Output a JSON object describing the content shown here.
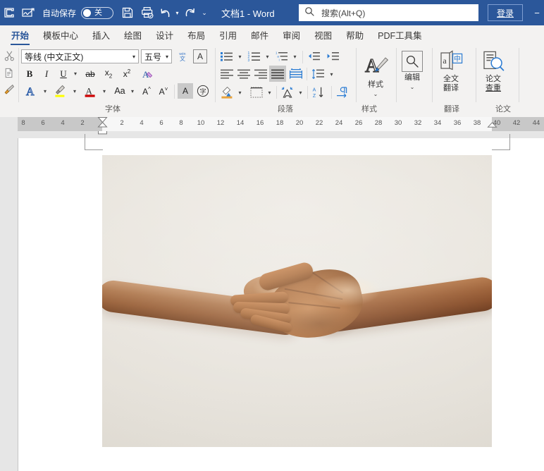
{
  "titlebar": {
    "autosave_label": "自动保存",
    "autosave_state": "关",
    "document_title": "文档1  -  Word",
    "signin_label": "登录",
    "icons": {
      "word_logo": "word-logo-icon",
      "signature": "signature-icon",
      "save": "save-icon",
      "print_preview": "print-preview-icon",
      "undo": "undo-icon",
      "redo": "redo-icon",
      "customize": "customize-qat-icon",
      "minimize": "minimize-icon"
    }
  },
  "search": {
    "placeholder": "搜索(Alt+Q)",
    "icon": "search-icon"
  },
  "tabs": [
    {
      "label": "开始",
      "active": true
    },
    {
      "label": "模板中心",
      "active": false
    },
    {
      "label": "插入",
      "active": false
    },
    {
      "label": "绘图",
      "active": false
    },
    {
      "label": "设计",
      "active": false
    },
    {
      "label": "布局",
      "active": false
    },
    {
      "label": "引用",
      "active": false
    },
    {
      "label": "邮件",
      "active": false
    },
    {
      "label": "审阅",
      "active": false
    },
    {
      "label": "视图",
      "active": false
    },
    {
      "label": "帮助",
      "active": false
    },
    {
      "label": "PDF工具集",
      "active": false
    }
  ],
  "ribbon": {
    "groups": [
      {
        "name": "clipboard",
        "label": ""
      },
      {
        "name": "font",
        "label": "字体"
      },
      {
        "name": "paragraph",
        "label": "段落"
      },
      {
        "name": "styles",
        "label": "样式"
      },
      {
        "name": "translate",
        "label": "翻译"
      },
      {
        "name": "thesis",
        "label": "论文"
      }
    ],
    "clipboard": {
      "cut": "cut-icon",
      "copy": "copy-icon",
      "format_painter": "format-painter-icon"
    },
    "font": {
      "font_name": "等线 (中文正文)",
      "font_size": "五号",
      "bold": "B",
      "italic": "I",
      "underline": "U",
      "strikethrough": "ab",
      "subscript": "x₂",
      "superscript": "x²",
      "phonetic_guide": "拼音指南",
      "character_border": "字符边框",
      "text_effects": "文本效果",
      "highlight": "突出显示",
      "font_color": "字体颜色",
      "change_case": "Aa",
      "grow_font": "增大字号",
      "shrink_font": "减小字号",
      "text_shading": "字符底纹",
      "enclose_character": "带圈字符",
      "clear_formatting": "清除格式"
    },
    "paragraph": {
      "bullets": "bullet-list-icon",
      "numbering": "numbered-list-icon",
      "multilevel": "multilevel-list-icon",
      "decrease_indent": "decrease-indent-icon",
      "increase_indent": "increase-indent-icon",
      "align_left": "align-left-icon",
      "align_center": "align-center-icon",
      "align_right": "align-right-icon",
      "justify": "justify-icon",
      "distribute": "distribute-icon",
      "line_spacing": "line-spacing-icon",
      "shading": "shading-icon",
      "borders": "borders-icon",
      "asian_layout": "asian-layout-icon",
      "sort": "sort-icon",
      "show_marks": "show-paragraph-marks-icon"
    },
    "styles": {
      "label": "样式",
      "icon": "styles-icon"
    },
    "editing": {
      "label": "编辑",
      "icon": "find-icon"
    },
    "translate": {
      "label": "全文\n翻译",
      "line1": "全文",
      "line2": "翻译",
      "icon": "translate-icon"
    },
    "thesis": {
      "line1": "论文",
      "line2": "查重",
      "icon": "plagiarism-check-icon"
    }
  },
  "ruler": {
    "left_numbers": [
      "8",
      "6",
      "4",
      "2"
    ],
    "right_numbers": [
      "2",
      "4",
      "6",
      "8",
      "10",
      "12",
      "14",
      "16",
      "18",
      "20",
      "22",
      "24",
      "26",
      "28",
      "30",
      "32",
      "34",
      "36",
      "38",
      "40",
      "42",
      "44"
    ],
    "left_indent_marker": "left-indent-marker",
    "right_indent_marker": "right-indent-marker"
  },
  "document": {
    "image_alt": "两只手相向伸出的照片",
    "image_subject": "two-hands-reaching",
    "background_color": "#E9E5DE",
    "selected": false
  },
  "colors": {
    "accent": "#2b579a",
    "ribbon_bg": "#f3f2f1",
    "doc_bg": "#e6e6e6",
    "highlight_yellow": "#ffff00",
    "font_color_red": "#cc0000"
  }
}
